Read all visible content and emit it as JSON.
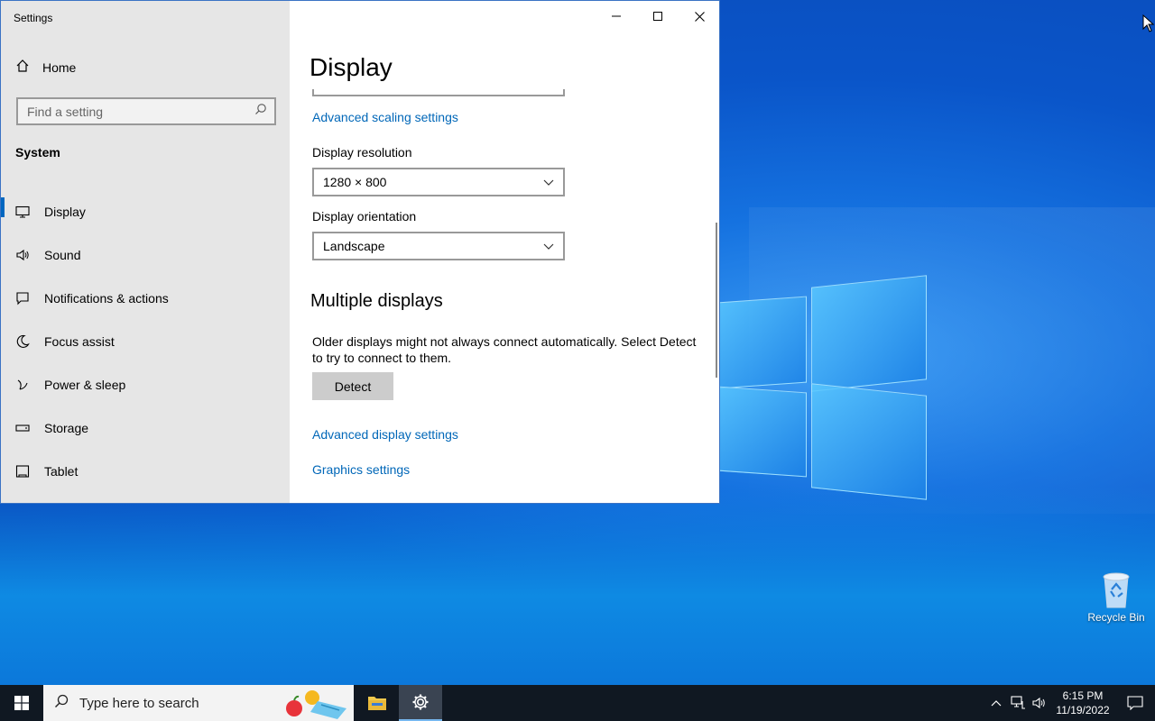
{
  "window": {
    "app_title": "Settings",
    "home_label": "Home",
    "search_placeholder": "Find a setting",
    "section_label": "System",
    "nav_items": [
      {
        "label": "Display",
        "icon": "monitor-icon",
        "active": true
      },
      {
        "label": "Sound",
        "icon": "speaker-icon"
      },
      {
        "label": "Notifications & actions",
        "icon": "notification-icon"
      },
      {
        "label": "Focus assist",
        "icon": "moon-icon"
      },
      {
        "label": "Power & sleep",
        "icon": "power-icon"
      },
      {
        "label": "Storage",
        "icon": "storage-icon"
      },
      {
        "label": "Tablet",
        "icon": "tablet-icon"
      }
    ]
  },
  "content": {
    "page_title": "Display",
    "advanced_scaling_link": "Advanced scaling settings",
    "resolution_label": "Display resolution",
    "resolution_value": "1280 × 800",
    "orientation_label": "Display orientation",
    "orientation_value": "Landscape",
    "multiple_displays_heading": "Multiple displays",
    "multiple_displays_desc": "Older displays might not always connect automatically. Select Detect to try to connect to them.",
    "detect_button": "Detect",
    "advanced_display_link": "Advanced display settings",
    "graphics_link": "Graphics settings"
  },
  "desktop": {
    "recycle_bin_label": "Recycle Bin"
  },
  "taskbar": {
    "search_placeholder": "Type here to search",
    "time": "6:15 PM",
    "date": "11/19/2022"
  },
  "colors": {
    "accent": "#0067c0",
    "link": "#0067b8",
    "sidebar_bg": "#e6e6e6",
    "taskbar_bg": "#101822"
  }
}
